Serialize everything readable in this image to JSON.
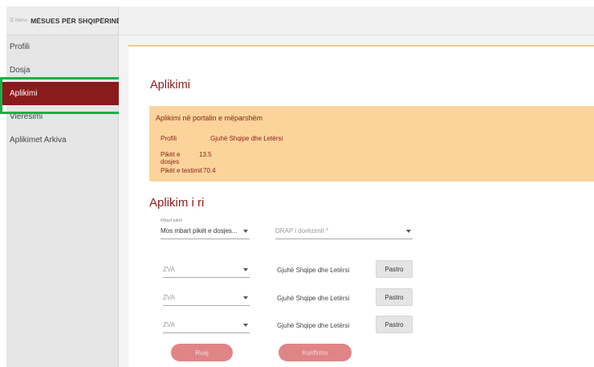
{
  "brand": {
    "mark": "☰ Menu",
    "title": "MËSUES PËR SHQIPËRINË"
  },
  "sidebar": {
    "items": [
      {
        "label": "Profili"
      },
      {
        "label": "Dosja"
      },
      {
        "label": "Aplikimi"
      },
      {
        "label": "Vlerësimi"
      },
      {
        "label": "Aplikimet Arkiva"
      }
    ]
  },
  "main": {
    "page_title": "Aplikimi",
    "previous": {
      "title": "Aplikimi në portalin e mëparshëm",
      "rows": [
        {
          "key": "Profili",
          "value": "Gjuhë Shqipe dhe Letërsi"
        },
        {
          "key": "Pikët e dosjes",
          "value": "13.5"
        },
        {
          "key": "Pikët e testimit",
          "value": "70.4"
        }
      ]
    },
    "new_section_title": "Aplikim i ri",
    "mbart": {
      "label": "Mbart pikët",
      "value": "Mos mbart pikët e dosjes..."
    },
    "drap": {
      "value": "DRAP i dorëzimit *"
    },
    "rows": [
      {
        "zva": "ZVA",
        "subject": "Gjuhë Shqipe dhe Letërsi",
        "button": "Pastro"
      },
      {
        "zva": "ZVA",
        "subject": "Gjuhë Shqipe dhe Letërsi",
        "button": "Pastro"
      },
      {
        "zva": "ZVA",
        "subject": "Gjuhë Shqipe dhe Letërsi",
        "button": "Pastro"
      }
    ],
    "ruaj_label": "Ruaj",
    "konfirmo_label": "Konfirmo"
  },
  "colors": {
    "accent": "#8b1a1d",
    "info_bg": "#fcd49b",
    "button_disabled": "#df8587",
    "highlight": "#16b14a"
  }
}
